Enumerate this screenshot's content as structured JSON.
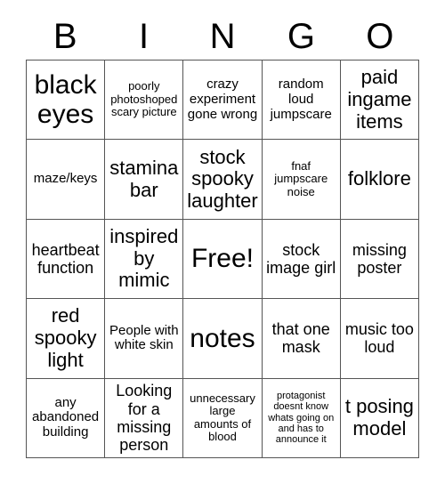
{
  "card": {
    "title_letters": [
      "B",
      "I",
      "N",
      "G",
      "O"
    ],
    "grid_size": 5,
    "free_space": "Free!",
    "rows": [
      [
        {
          "text": "black eyes",
          "size": "s-xxl"
        },
        {
          "text": "poorly photoshoped scary picture",
          "size": "s-xs"
        },
        {
          "text": "crazy experiment gone wrong",
          "size": "s-sm"
        },
        {
          "text": "random loud jumpscare",
          "size": "s-sm"
        },
        {
          "text": "paid ingame items",
          "size": "s-lg"
        }
      ],
      [
        {
          "text": "maze/keys",
          "size": "s-sm"
        },
        {
          "text": "stamina bar",
          "size": "s-lg"
        },
        {
          "text": "stock spooky laughter",
          "size": "s-lg"
        },
        {
          "text": "fnaf jumpscare noise",
          "size": "s-xs"
        },
        {
          "text": "folklore",
          "size": "s-lg"
        }
      ],
      [
        {
          "text": "heartbeat function",
          "size": "s-md"
        },
        {
          "text": "inspired by mimic",
          "size": "s-lg"
        },
        {
          "text": "Free!",
          "size": "s-xxl"
        },
        {
          "text": "stock image girl",
          "size": "s-md"
        },
        {
          "text": "missing poster",
          "size": "s-md"
        }
      ],
      [
        {
          "text": "red spooky light",
          "size": "s-lg"
        },
        {
          "text": "People with white skin",
          "size": "s-sm"
        },
        {
          "text": "notes",
          "size": "s-xxl"
        },
        {
          "text": "that one mask",
          "size": "s-md"
        },
        {
          "text": "music too loud",
          "size": "s-md"
        }
      ],
      [
        {
          "text": "any abandoned building",
          "size": "s-sm"
        },
        {
          "text": "Looking for a missing person",
          "size": "s-md"
        },
        {
          "text": "unnecessary large amounts of blood",
          "size": "s-xs"
        },
        {
          "text": "protagonist doesnt know whats going on and has to announce it",
          "size": "s-xxs"
        },
        {
          "text": "t posing model",
          "size": "s-lg"
        }
      ]
    ]
  },
  "colors": {
    "background": "#ffffff",
    "text": "#000000",
    "grid_line": "#555555"
  }
}
